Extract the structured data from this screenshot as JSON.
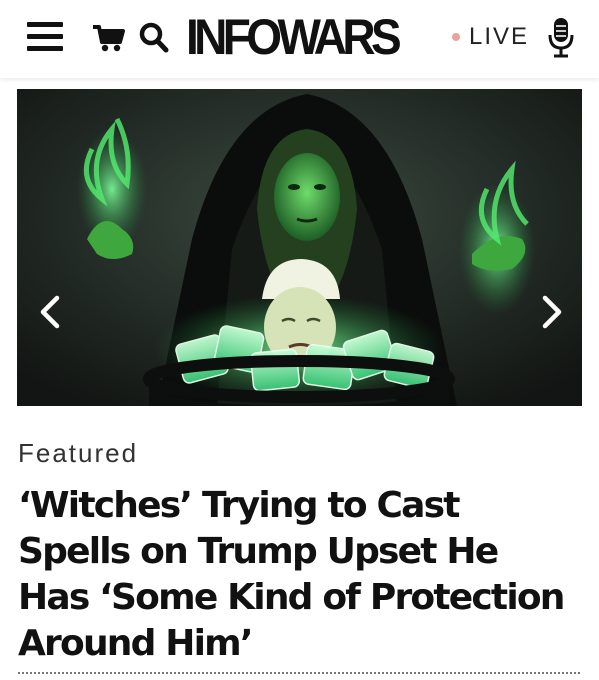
{
  "header": {
    "menu_icon": "hamburger-menu-icon",
    "cart_icon": "shopping-cart-icon",
    "search_icon": "search-icon",
    "logo_text": "INFOWARS",
    "live_label": "LIVE",
    "live_dot_color": "#e9a39a",
    "mic_icon": "microphone-icon"
  },
  "carousel": {
    "prev_icon": "chevron-left-icon",
    "next_icon": "chevron-right-icon",
    "glow_color": "#39d46a"
  },
  "article": {
    "kicker": "Featured",
    "headline": "‘Witches’ Trying to Cast Spells on Trump Upset He Has ‘Some Kind of Protection Around Him’"
  }
}
